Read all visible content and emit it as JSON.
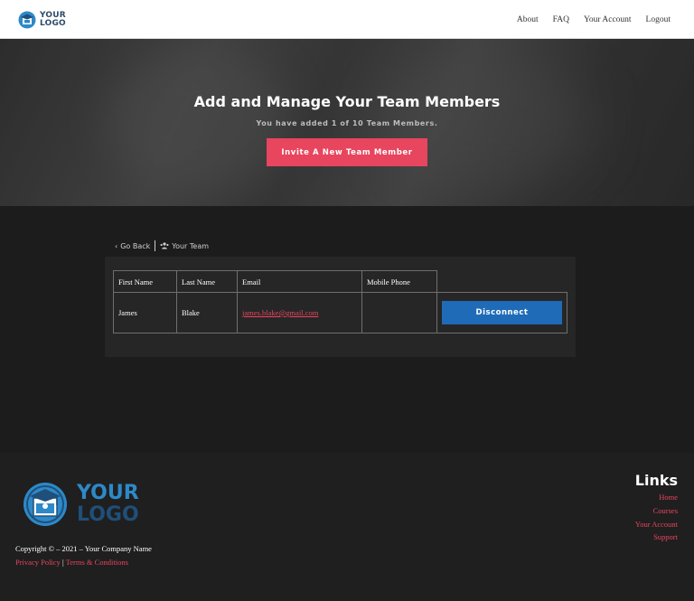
{
  "header": {
    "logo": {
      "line1": "YOUR",
      "line2": "LOGO"
    },
    "nav": [
      "About",
      "FAQ",
      "Your Account",
      "Logout"
    ]
  },
  "hero": {
    "title": "Add and Manage Your Team Members",
    "subtitle": "You have added 1 of 10 Team Members.",
    "invite_label": "Invite A New Team Member"
  },
  "breadcrumb": {
    "back_label": "Go Back",
    "back_icon": "chevron-left-icon",
    "current_label": "Your Team",
    "current_icon": "users-icon"
  },
  "table": {
    "columns": [
      "First Name",
      "Last Name",
      "Email",
      "Mobile Phone"
    ],
    "rows": [
      {
        "first": "James",
        "last": "Blake",
        "email": "james.blake@gmail.com",
        "phone": "",
        "action": "Disconnect"
      }
    ]
  },
  "footer": {
    "logo": {
      "line1": "YOUR",
      "line2": "LOGO"
    },
    "copyright": "Copyright © – 2021 – Your Company Name",
    "privacy": "Privacy Policy",
    "separator": "|",
    "terms": "Terms & Conditions",
    "links_title": "Links",
    "links": [
      "Home",
      "Courses",
      "Your Account",
      "Support"
    ]
  },
  "colors": {
    "accent": "#e8455e",
    "button_blue": "#1f6bb8",
    "background": "#1c1c1c"
  }
}
